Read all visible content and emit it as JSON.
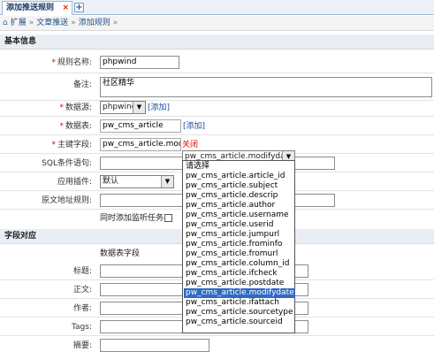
{
  "tabs": {
    "active": "添加推送规则",
    "close": "×",
    "add": "+"
  },
  "breadcrumb": {
    "items": [
      "扩展",
      "文章推送",
      "添加规则"
    ],
    "separator": "»",
    "trailing": "»"
  },
  "sections": {
    "basic": "基本信息",
    "fields": "字段对应"
  },
  "form": {
    "rule_name": {
      "label": "规则名称:",
      "value": "phpwind"
    },
    "note": {
      "label": "备注:",
      "value": "社区精华"
    },
    "data_source": {
      "label": "数据源:",
      "value": "phpwind",
      "add_link": "[添加]"
    },
    "data_table": {
      "label": "数据表:",
      "value": "pw_cms_article",
      "add_link": "[添加]"
    },
    "primary_field": {
      "label": "主键字段:",
      "value": "pw_cms_article.modify",
      "close_link": "关闭"
    },
    "sql_condition": {
      "label": "SQL条件语句:",
      "value": ""
    },
    "plugin": {
      "label": "应用插件:",
      "value": "默认"
    },
    "source_url": {
      "label": "原文地址规则:",
      "value": ""
    },
    "add_task": {
      "label": "同时添加监听任务"
    }
  },
  "field_map": {
    "column_header": "数据表字段",
    "rows": [
      {
        "label": "标题:"
      },
      {
        "label": "正文:"
      },
      {
        "label": "作者:"
      },
      {
        "label": "Tags:"
      },
      {
        "label": "摘要:"
      }
    ]
  },
  "dropdown": {
    "selected": "pw_cms_article.modifydate",
    "options": [
      "请选择",
      "pw_cms_article.article_id",
      "pw_cms_article.subject",
      "pw_cms_article.descrip",
      "pw_cms_article.author",
      "pw_cms_article.username",
      "pw_cms_article.userid",
      "pw_cms_article.jumpurl",
      "pw_cms_article.frominfo",
      "pw_cms_article.fromurl",
      "pw_cms_article.column_id",
      "pw_cms_article.ifcheck",
      "pw_cms_article.postdate",
      "pw_cms_article.modifydate",
      "pw_cms_article.ifattach",
      "pw_cms_article.sourcetype",
      "pw_cms_article.sourceid"
    ],
    "highlighted_index": 13
  }
}
